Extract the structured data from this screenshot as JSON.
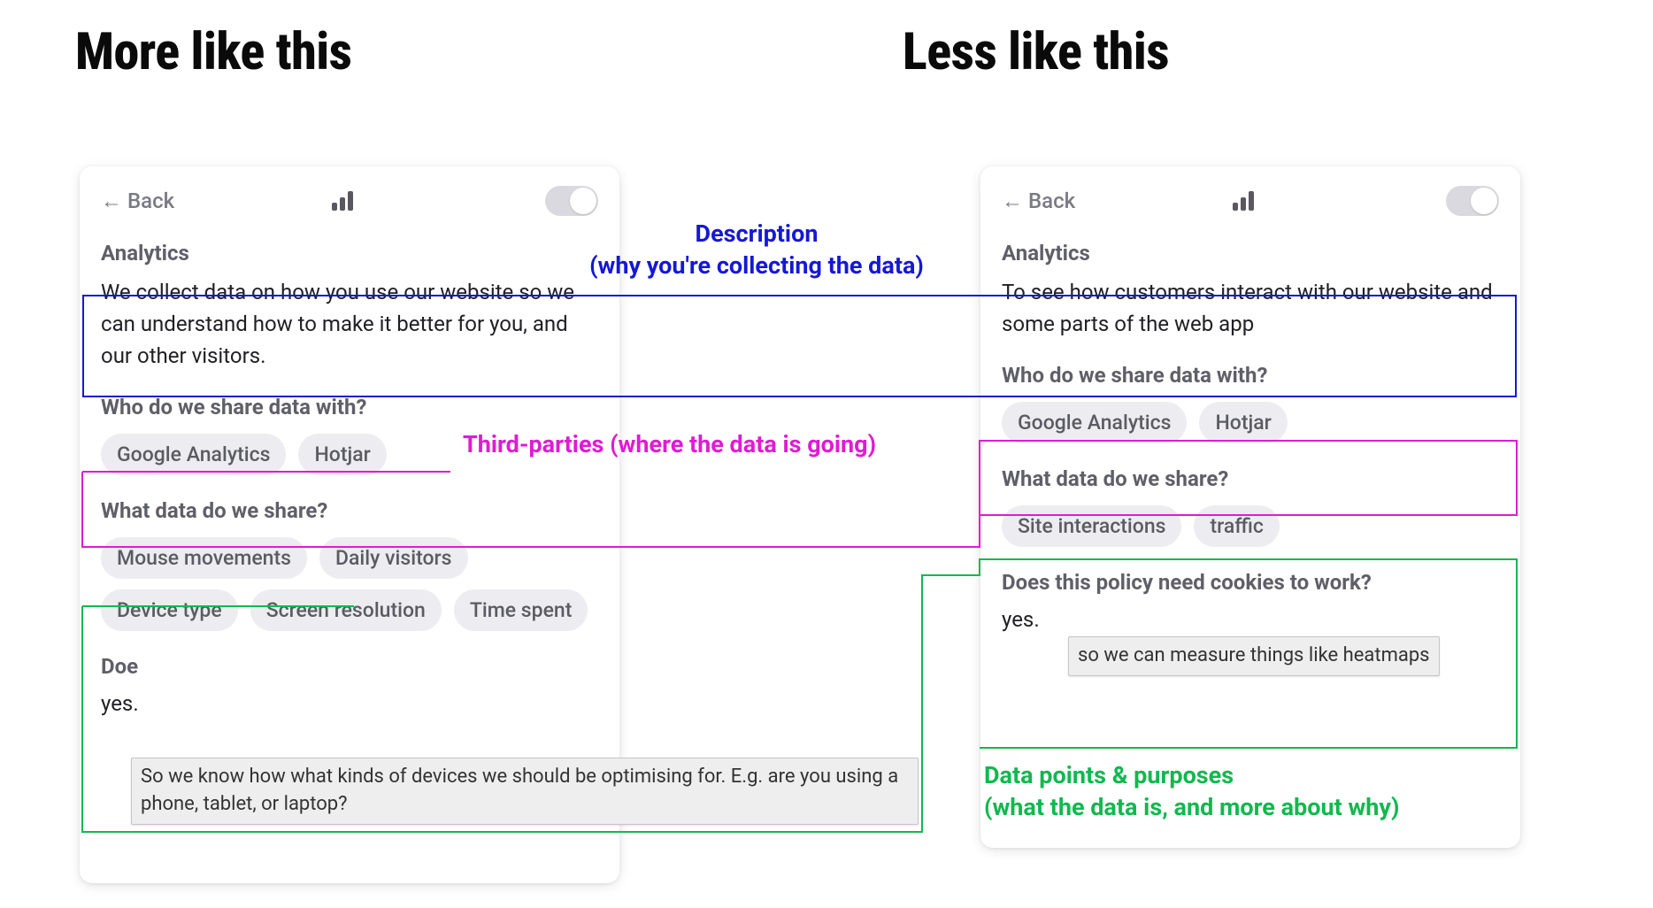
{
  "headings": {
    "more": "More like this",
    "less": "Less like this"
  },
  "annotations": {
    "description": "Description\n(why you're collecting the data)",
    "third_parties": "Third-parties (where the data is going)",
    "data_points": "Data points & purposes\n(what the data is, and more about why)"
  },
  "colors": {
    "blue": "#1518d6",
    "magenta": "#e01bd3",
    "green": "#11b84f"
  },
  "card_left": {
    "back_label": "Back",
    "title": "Analytics",
    "description": "We collect data on how you use our website so we can understand how to make it better for you, and our other visitors.",
    "share_heading": "Who do we share data with?",
    "share_pills": [
      "Google Analytics",
      "Hotjar"
    ],
    "data_heading": "What data do we share?",
    "data_pills": [
      "Mouse movements",
      "Daily visitors",
      "Device type",
      "Screen resolution",
      "Time spent"
    ],
    "cookie_question_prefix": "Doe",
    "cookie_answer": "yes.",
    "tooltip": "So we know how what kinds of devices we should be optimising for. E.g. are you using a phone, tablet, or laptop?"
  },
  "card_right": {
    "back_label": "Back",
    "title": "Analytics",
    "description": "To see how customers interact with our website and some parts of the web app",
    "share_heading": "Who do we share data with?",
    "share_pills": [
      "Google Analytics",
      "Hotjar"
    ],
    "data_heading": "What data do we share?",
    "data_pills": [
      "Site interactions",
      "traffic"
    ],
    "cookie_question": "Does this policy need cookies to work?",
    "cookie_answer": "yes.",
    "tooltip": "so we can measure things like heatmaps"
  }
}
